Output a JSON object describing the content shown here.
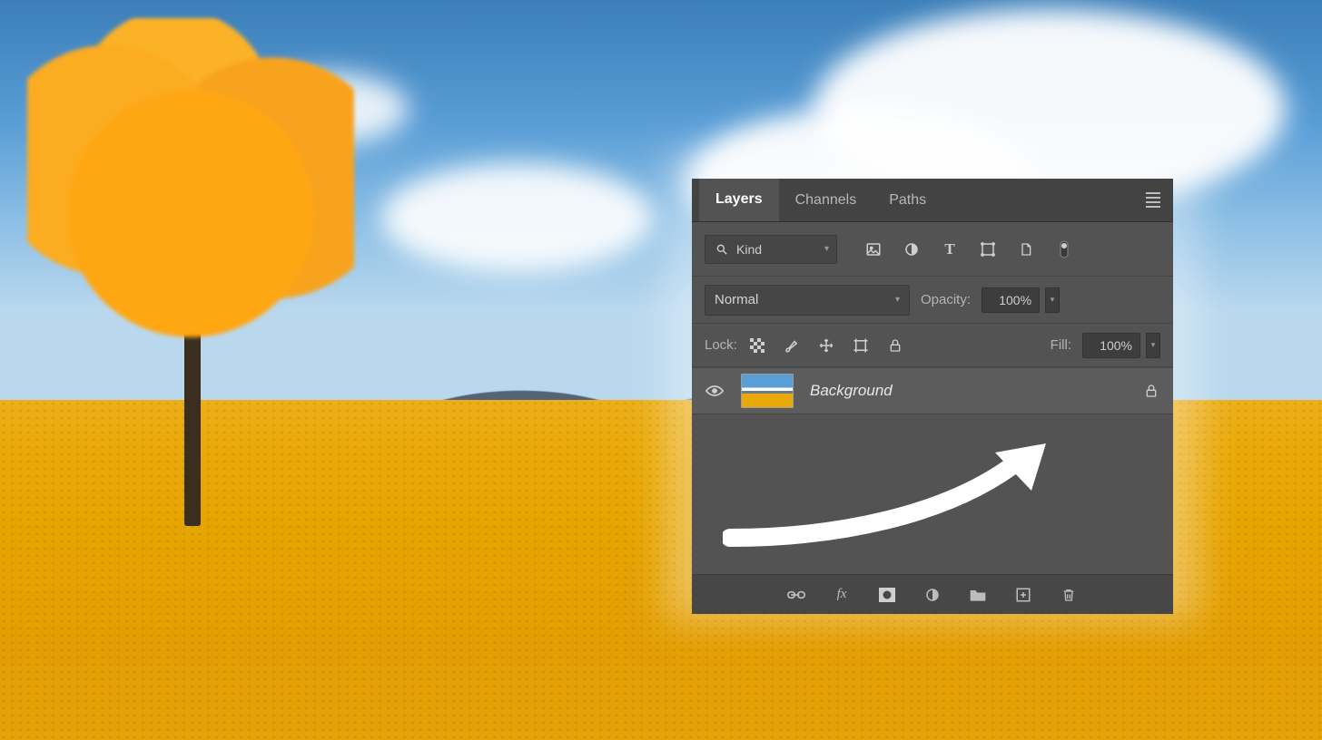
{
  "panel": {
    "tabs": {
      "layers": "Layers",
      "channels": "Channels",
      "paths": "Paths"
    },
    "active_tab": "layers",
    "filter": {
      "kind_label": "Kind"
    },
    "blend": {
      "mode": "Normal",
      "opacity_label": "Opacity:",
      "opacity_value": "100%"
    },
    "lock": {
      "label": "Lock:",
      "fill_label": "Fill:",
      "fill_value": "100%"
    },
    "layer": {
      "name": "Background"
    },
    "icons": {
      "search": "search-icon",
      "image_filter": "image-filter-icon",
      "adjust_filter": "adjustment-filter-icon",
      "type_filter": "type-filter-icon",
      "shape_filter": "shape-filter-icon",
      "smart_filter": "smart-object-filter-icon",
      "toggle": "filter-toggle-icon",
      "lock_pixels": "lock-pixels-icon",
      "lock_brush": "lock-brush-icon",
      "lock_position": "lock-position-icon",
      "lock_artboard": "lock-artboard-icon",
      "lock_all": "lock-all-icon",
      "eye": "visibility-icon",
      "layer_lock": "layer-locked-icon",
      "link": "link-layers-icon",
      "fx": "layer-style-icon",
      "mask": "add-mask-icon",
      "adjustment": "new-adjustment-icon",
      "group": "new-group-icon",
      "new": "new-layer-icon",
      "trash": "delete-layer-icon",
      "menu": "panel-menu-icon"
    }
  }
}
